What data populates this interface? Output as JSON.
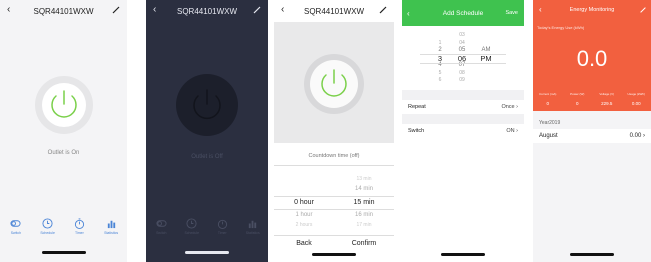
{
  "screen1": {
    "title": "SQR44101WXW",
    "status": "Outlet is On",
    "tabs": [
      {
        "label": "Switch",
        "icon": "toggle-icon"
      },
      {
        "label": "Schedule",
        "icon": "clock-icon"
      },
      {
        "label": "Timer",
        "icon": "timer-icon"
      },
      {
        "label": "Statistics",
        "icon": "bar-chart-icon"
      }
    ],
    "accent": "#7ad04a"
  },
  "screen2": {
    "title": "SQR44101WXW",
    "status": "Outlet is Off",
    "tabs": [
      {
        "label": "Switch"
      },
      {
        "label": "Schedule"
      },
      {
        "label": "Timer"
      },
      {
        "label": "Statistics"
      }
    ]
  },
  "screen3": {
    "title": "SQR44101WXW",
    "countdown_title": "Countdown time (off)",
    "picker": [
      {
        "hour": "",
        "min": "13 min"
      },
      {
        "hour": "",
        "min": "14 min"
      },
      {
        "hour": "0 hour",
        "min": "15 min"
      },
      {
        "hour": "1 hour",
        "min": "16 min"
      },
      {
        "hour": "2 hours",
        "min": "17 min"
      }
    ],
    "back_label": "Back",
    "confirm_label": "Confirm"
  },
  "screen4": {
    "title": "Add Schedule",
    "save_label": "Save",
    "hours": [
      "",
      "1",
      "2",
      "3",
      "4",
      "5",
      "6"
    ],
    "minutes": [
      "03",
      "04",
      "05",
      "06",
      "07",
      "08",
      "09"
    ],
    "ampm": [
      "AM",
      "PM"
    ],
    "repeat_label": "Repeat",
    "repeat_value": "Once",
    "switch_label": "Switch",
    "switch_value": "ON"
  },
  "screen5": {
    "title": "Energy Monitoring",
    "today_label": "Today's Energy Use (kWh)",
    "energy_value": "0.0",
    "metrics": [
      {
        "label": "Current (mA)",
        "value": "0"
      },
      {
        "label": "Power (W)",
        "value": "0"
      },
      {
        "label": "Voltage (V)",
        "value": "229.5"
      },
      {
        "label": "Usage (kWh)",
        "value": "0.00"
      }
    ],
    "year": "Year2019",
    "month": "August",
    "month_value": "0.00",
    "accent": "#f2603f"
  }
}
